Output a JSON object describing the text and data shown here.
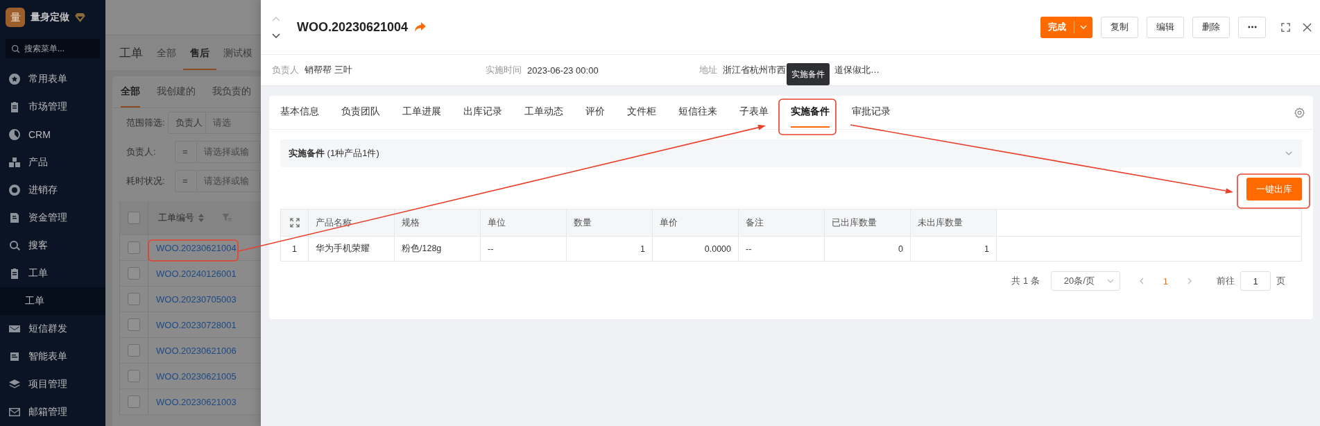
{
  "sidebar": {
    "brand": {
      "logo_text": "量",
      "name": "量身定做"
    },
    "search": {
      "placeholder": "搜索菜单..."
    },
    "items": [
      {
        "label": "常用表单"
      },
      {
        "label": "市场管理"
      },
      {
        "label": "CRM"
      },
      {
        "label": "产品"
      },
      {
        "label": "进销存"
      },
      {
        "label": "资金管理"
      },
      {
        "label": "搜客"
      },
      {
        "label": "工单",
        "children": [
          {
            "label": "工单",
            "selected": true
          }
        ]
      },
      {
        "label": "短信群发"
      },
      {
        "label": "智能表单"
      },
      {
        "label": "项目管理"
      },
      {
        "label": "邮箱管理"
      }
    ]
  },
  "background_page": {
    "title": "工单",
    "tabs": [
      {
        "label": "全部",
        "selected": false
      },
      {
        "label": "售后",
        "selected": true
      },
      {
        "label": "测试模",
        "selected": false
      }
    ],
    "sub_tabs": [
      {
        "label": "全部",
        "selected": true
      },
      {
        "label": "我创建的",
        "selected": false
      },
      {
        "label": "我负责的",
        "selected": false
      }
    ],
    "filters": [
      {
        "label": "范围筛选:",
        "operator": "负责人",
        "placeholder": "请选"
      },
      {
        "label": "负责人:",
        "operator": "=",
        "placeholder": "请选择或输"
      },
      {
        "label": "耗时状况:",
        "operator": "=",
        "placeholder": "请选择或输"
      }
    ],
    "table": {
      "column": "工单编号",
      "header_checked": false,
      "rows": [
        {
          "number": "WOO.20230621004",
          "checked": false
        },
        {
          "number": "WOO.20240126001",
          "checked": false
        },
        {
          "number": "WOO.20230705003",
          "checked": false
        },
        {
          "number": "WOO.20230728001",
          "checked": false
        },
        {
          "number": "WOO.20230621006",
          "checked": false
        },
        {
          "number": "WOO.20230621005",
          "checked": false
        },
        {
          "number": "WOO.20230621003",
          "checked": false
        }
      ]
    }
  },
  "drawer": {
    "title": "WOO.20230621004",
    "primary_button": "完成",
    "buttons": [
      "复制",
      "编辑",
      "删除"
    ],
    "info": [
      {
        "label": "负责人",
        "value": "销帮帮 三叶"
      },
      {
        "label": "实施时间",
        "value": "2023-06-23 00:00"
      },
      {
        "label": "地址",
        "value": "浙江省杭州市西",
        "value_after_tooltip": "道保俶北…"
      }
    ],
    "tooltip": "实施备件",
    "tabs": [
      {
        "label": "基本信息",
        "selected": false
      },
      {
        "label": "负责团队",
        "selected": false
      },
      {
        "label": "工单进展",
        "selected": false
      },
      {
        "label": "出库记录",
        "selected": false
      },
      {
        "label": "工单动态",
        "selected": false
      },
      {
        "label": "评价",
        "selected": false
      },
      {
        "label": "文件柜",
        "selected": false
      },
      {
        "label": "短信往来",
        "selected": false
      },
      {
        "label": "子表单",
        "selected": false
      },
      {
        "label": "实施备件",
        "selected": true
      },
      {
        "label": "审批记录",
        "selected": false
      }
    ],
    "panel": {
      "title": "**实施备件** (1种产品1件)"
    },
    "action_button": "一键出库",
    "table": {
      "columns": [
        {
          "label": "产品名称",
          "numeric": false
        },
        {
          "label": "规格",
          "numeric": false
        },
        {
          "label": "单位",
          "numeric": false
        },
        {
          "label": "数量",
          "numeric": true
        },
        {
          "label": "单价",
          "numeric": true
        },
        {
          "label": "备注",
          "numeric": false
        },
        {
          "label": "已出库数量",
          "numeric": true
        },
        {
          "label": "未出库数量",
          "numeric": true
        }
      ],
      "rows": [
        {
          "index": "1",
          "cells": [
            "华为手机荣耀",
            "粉色/128g",
            "--",
            "1",
            "0.0000",
            "--",
            "0",
            "1"
          ]
        }
      ]
    },
    "pagination": {
      "total": "共 1 条",
      "page_size": "20条/页",
      "pages": [
        {
          "label": "1",
          "selected": true
        }
      ],
      "jump_label": "前往",
      "jump_value": "1",
      "jump_suffix": "页"
    }
  }
}
